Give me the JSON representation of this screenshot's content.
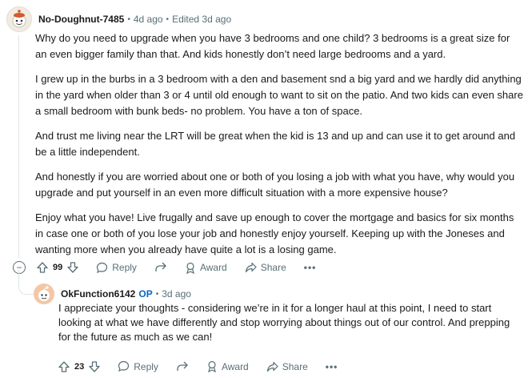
{
  "comment": {
    "author": "No-Doughnut-7485",
    "time": "4d ago",
    "edited": "Edited 3d ago",
    "paragraphs": [
      "Why do you need to upgrade when you have 3 bedrooms and one child? 3 bedrooms is a great size for an even bigger family than that. And kids honestly don’t need large bedrooms and a yard.",
      "I grew up in the burbs in a 3 bedroom with a den and basement snd a big yard and we hardly did anything in the yard when older than 3 or 4 until old enough to want to sit on the patio. And two kids can even share a small bedroom with bunk beds- no problem. You have a ton of space.",
      "And trust me living near the LRT will be great when the kid is 13 and up and can use it to get around and be a little independent.",
      "And honestly if you are worried about one or both of you losing a job with what you have, why would you upgrade and put yourself in an even more difficult situation with a more expensive house?",
      "Enjoy what you have! Live frugally and save up enough to cover the mortgage and basics for six months in case one or both of you lose your job and honestly enjoy yourself. Keeping up with the Joneses and wanting more when you already have quite a lot is a losing game."
    ],
    "votes": "99",
    "reply_label": "Reply",
    "award_label": "Award",
    "share_label": "Share",
    "more_label": "•••",
    "collapse_label": "−"
  },
  "reply": {
    "author": "OkFunction6142",
    "op_badge": "OP",
    "time": "3d ago",
    "text": "I appreciate your thoughts - considering we’re in it for a longer haul at this point, I need to start looking at what we have differently and stop worrying about things out of our control. And prepping for the future as much as we can!",
    "votes": "23",
    "reply_label": "Reply",
    "award_label": "Award",
    "share_label": "Share",
    "more_label": "•••"
  },
  "colors": {
    "meta": "#576f76",
    "op": "#0a66c2",
    "text": "#1a1a1b"
  },
  "icons": [
    "avatar-snoo",
    "upvote-icon",
    "downvote-icon",
    "reply-icon",
    "award-icon",
    "share-icon",
    "more-icon",
    "collapse-icon"
  ]
}
